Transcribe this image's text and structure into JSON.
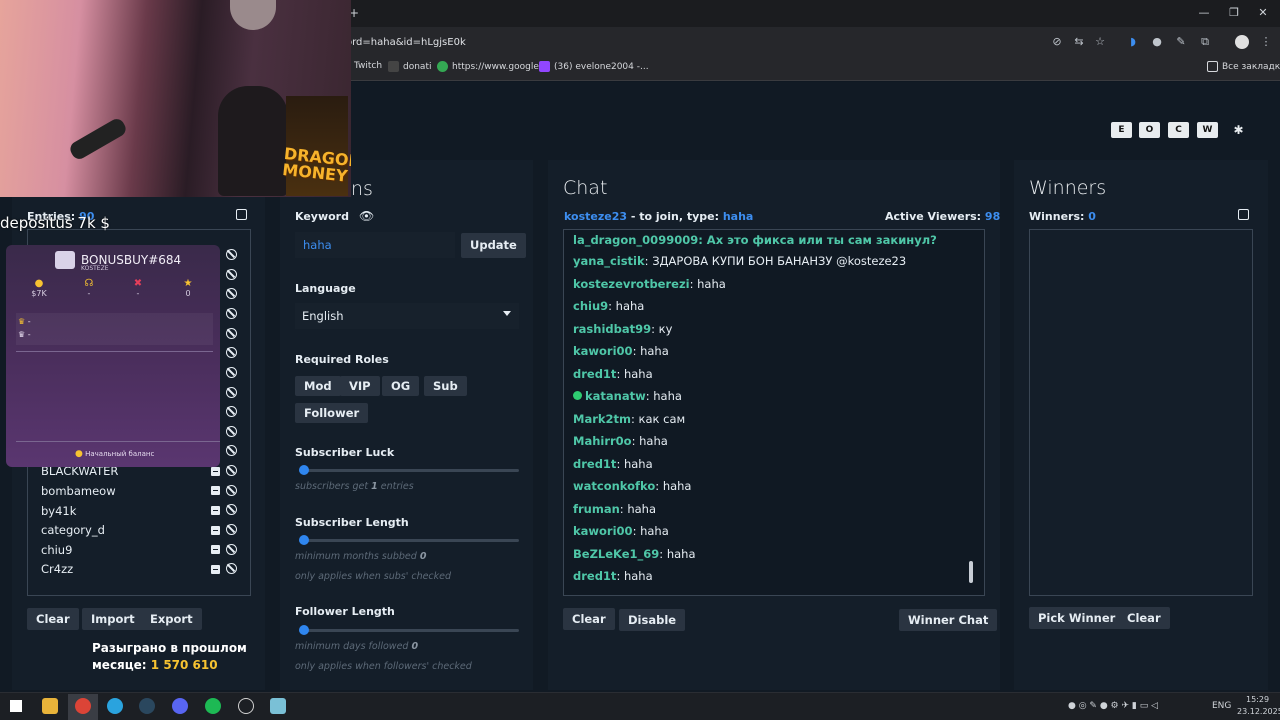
{
  "browser": {
    "url": "ord=haha&id=hLgjsE0k",
    "new_tab": "+",
    "bookmarks": [
      {
        "label": "Twitch",
        "color": "#9146ff"
      },
      {
        "label": "donati",
        "color": "#444444"
      },
      {
        "label": "https://www.google....",
        "color": "#34a853"
      },
      {
        "label": "(36) evelone2004 -...",
        "color": "#9146ff"
      }
    ],
    "all_bookmarks": "Все закладки"
  },
  "stream_overlay": {
    "deposit_text": "depositus 7k $",
    "poster_text": "DRAGON MONEY",
    "bonus": {
      "title": "BONUSBUY#684",
      "subtitle": "KOSTEZE",
      "stats": [
        "$7K",
        "-",
        "-",
        "0"
      ],
      "rows": [
        "-",
        "-"
      ],
      "footer": "Начальный баланс"
    },
    "prize_line1": "Разыграно в прошлом",
    "prize_line2_label": "месяце:",
    "prize_amount": "1 570 610"
  },
  "top_buttons": [
    "E",
    "O",
    "C",
    "W",
    "✱"
  ],
  "entries": {
    "label": "Entries:",
    "count": "90",
    "names": [
      "BLACKWATER",
      "bombameow",
      "by41k",
      "category_d",
      "chiu9",
      "Cr4zz"
    ],
    "clear": "Clear",
    "import": "Import",
    "export": "Export"
  },
  "options": {
    "title_partial": "ns",
    "keyword_label": "Keyword",
    "keyword_value": "haha",
    "update": "Update",
    "language_label": "Language",
    "language_value": "English",
    "roles_label": "Required Roles",
    "roles": [
      "Mod",
      "VIP",
      "OG",
      "Sub",
      "Follower"
    ],
    "sub_luck_label": "Subscriber Luck",
    "sub_luck_hint_pre": "subscribers get",
    "sub_luck_value": "1",
    "sub_luck_hint_post": "entries",
    "sub_luck_level": 0,
    "sub_length_label": "Subscriber Length",
    "sub_length_hint": "minimum months subbed",
    "sub_length_value": "0",
    "sub_length_note": "only applies when subs' checked",
    "sub_length_level": 0,
    "follower_length_label": "Follower Length",
    "follower_length_hint": "minimum days followed",
    "follower_length_value": "0",
    "follower_length_note": "only applies when followers' checked",
    "follower_length_level": 0
  },
  "chat": {
    "title": "Chat",
    "join_user": "kosteze23",
    "join_text": "- to join, type:",
    "join_keyword": "haha",
    "viewers_label": "Active Viewers:",
    "viewers": "98",
    "cut_line": "la_dragon_0099009: Ах это фикса или ты сам закинул?",
    "messages": [
      {
        "user": "yana_cistik",
        "text": "ЗДАРОВА КУПИ БОН БАНАНЗУ @kosteze23"
      },
      {
        "user": "kostezevrotberezi",
        "text": "haha"
      },
      {
        "user": "chiu9",
        "text": "haha"
      },
      {
        "user": "rashidbat99",
        "text": "ку"
      },
      {
        "user": "kawori00",
        "text": "haha"
      },
      {
        "user": "dred1t",
        "text": "haha"
      },
      {
        "user": "katanatw",
        "text": "haha",
        "badge": true
      },
      {
        "user": "Mark2tm",
        "text": "как сам"
      },
      {
        "user": "Mahirr0o",
        "text": "haha"
      },
      {
        "user": "dred1t",
        "text": "haha"
      },
      {
        "user": "watconkofko",
        "text": "haha"
      },
      {
        "user": "fruman",
        "text": "haha"
      },
      {
        "user": "kawori00",
        "text": "haha"
      },
      {
        "user": "BeZLeKe1_69",
        "text": "haha"
      },
      {
        "user": "dred1t",
        "text": "haha"
      }
    ],
    "clear": "Clear",
    "disable": "Disable",
    "winner_chat": "Winner Chat"
  },
  "winners": {
    "title": "Winners",
    "label": "Winners:",
    "count": "0",
    "pick": "Pick Winner",
    "clear": "Clear"
  },
  "taskbar": {
    "lang": "ENG",
    "time": "15:29",
    "date": "23.12.2025"
  }
}
